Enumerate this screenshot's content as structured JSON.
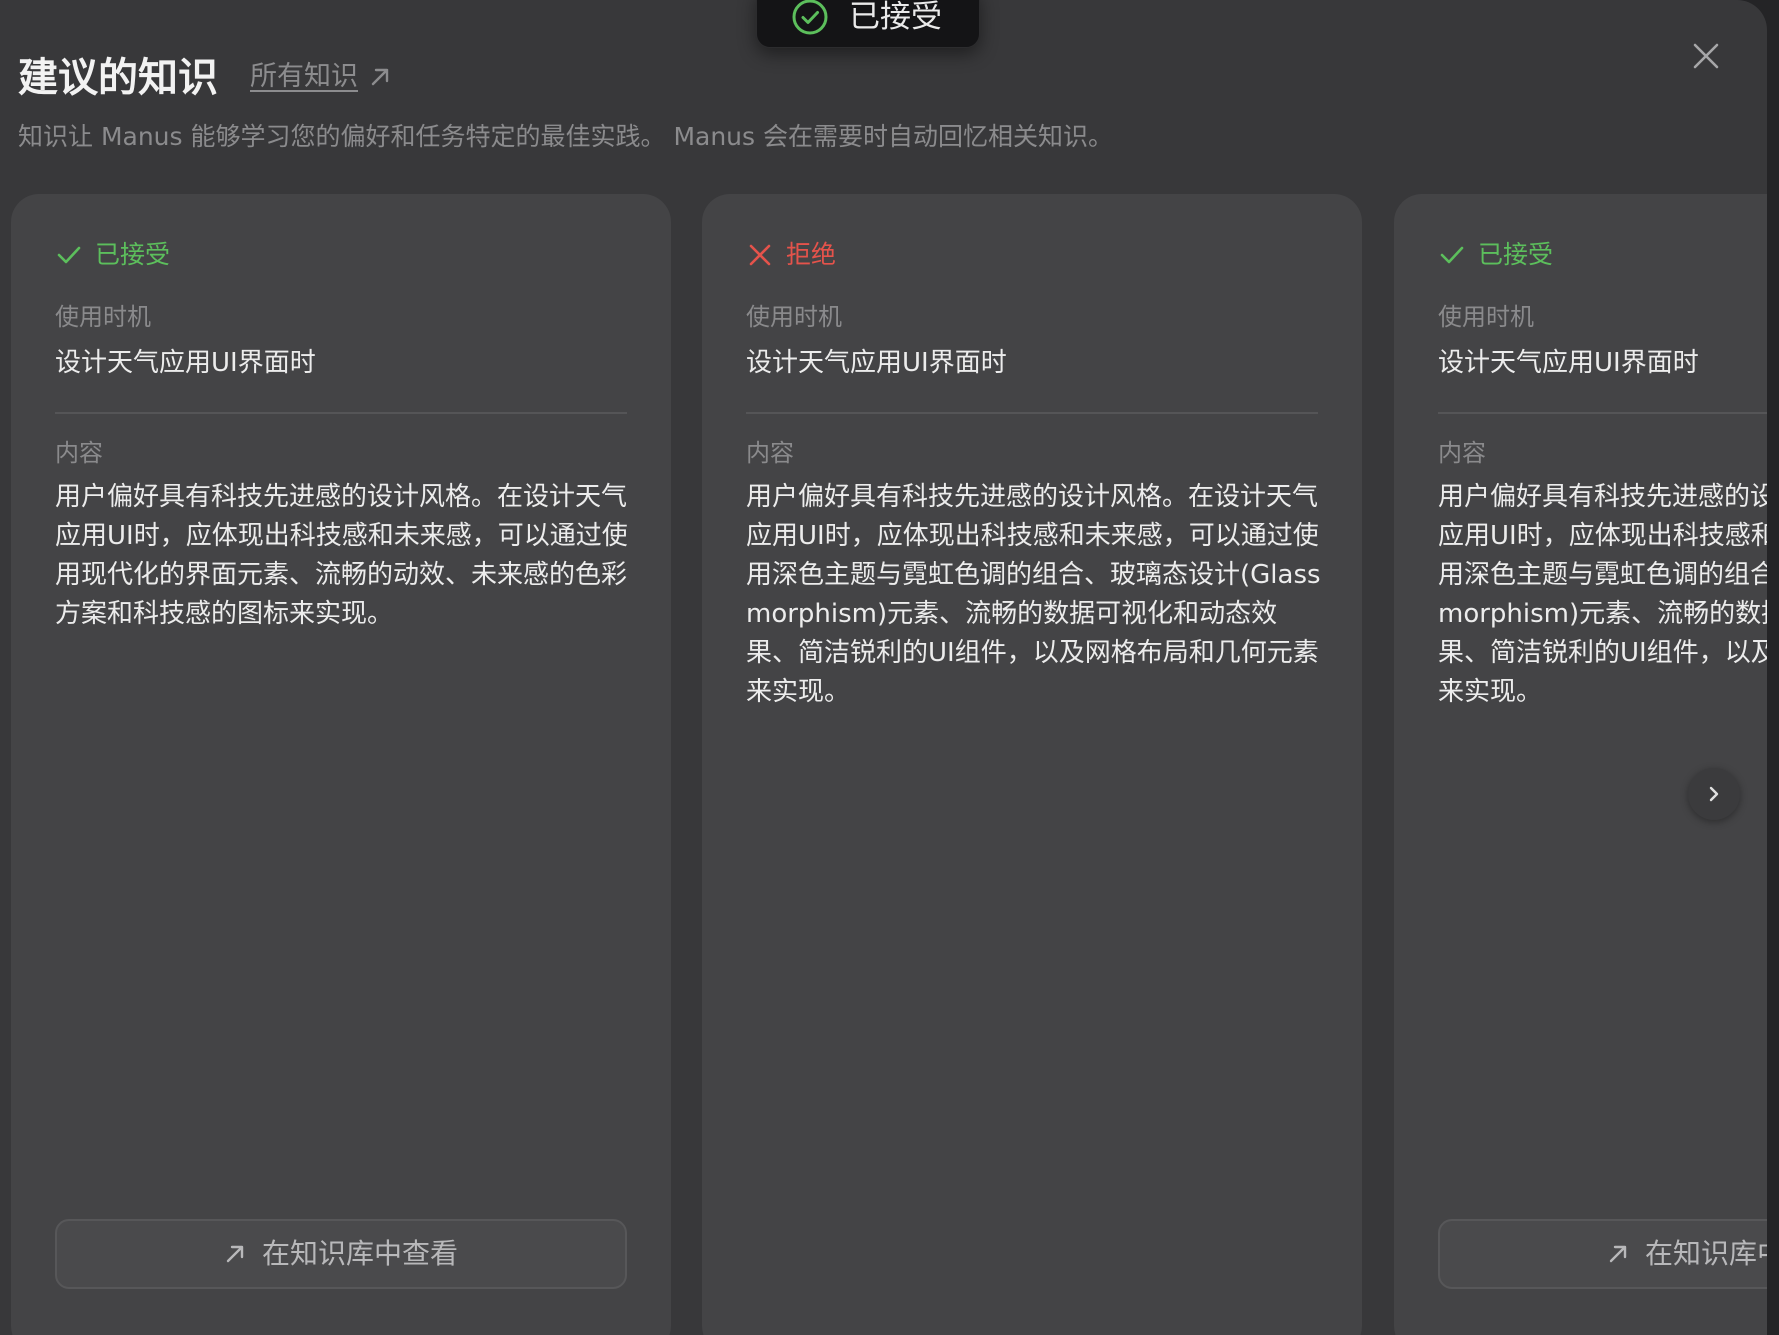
{
  "header": {
    "title": "建议的知识",
    "all_knowledge_link": "所有知识",
    "description": "知识让 Manus 能够学习您的偏好和任务特定的最佳实践。 Manus 会在需要时自动回忆相关知识。"
  },
  "toast": {
    "text": "已接受",
    "icon": "check-circle-icon"
  },
  "labels": {
    "when": "使用时机",
    "content": "内容",
    "view_in_kb": "在知识库中查看"
  },
  "cards": [
    {
      "status": "已接受",
      "status_type": "accepted",
      "status_icon": "check-icon",
      "when": "设计天气应用UI界面时",
      "content": "用户偏好具有科技先进感的设计风格。在设计天气应用UI时，应体现出科技感和未来感，可以通过使用现代化的界面元素、流畅的动效、未来感的色彩方案和科技感的图标来实现。"
    },
    {
      "status": "拒绝",
      "status_type": "rejected",
      "status_icon": "x-icon",
      "when": "设计天气应用UI界面时",
      "content": "用户偏好具有科技先进感的设计风格。在设计天气应用UI时，应体现出科技感和未来感，可以通过使用深色主题与霓虹色调的组合、玻璃态设计(Glassmorphism)元素、流畅的数据可视化和动态效果、简洁锐利的UI组件，以及网格布局和几何元素来实现。"
    },
    {
      "status": "已接受",
      "status_type": "accepted",
      "status_icon": "check-icon",
      "when": "设计天气应用UI界面时",
      "content": "用户偏好具有科技先进感的设计风格。在设计天气应用UI时，应体现出科技感和未来感，可以通过使用深色主题与霓虹色调的组合、玻璃态设计(Glassmorphism)元素、流畅的数据可视化和动态效果、简洁锐利的UI组件，以及网格布局和几何元素来实现。"
    }
  ],
  "colors": {
    "accepted": "#5cbf5c",
    "rejected": "#e5534b",
    "card_bg": "#444446",
    "modal_bg": "#38383a"
  }
}
